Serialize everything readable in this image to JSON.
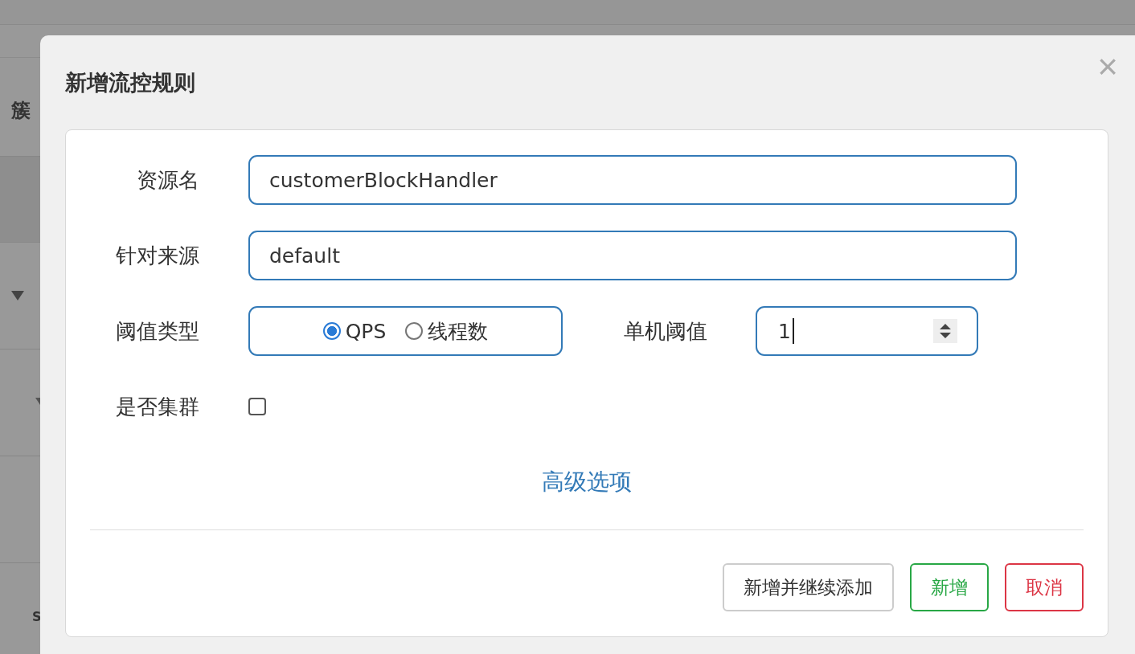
{
  "background": {
    "heading": "簇",
    "footer_text": "S"
  },
  "dialog": {
    "title": "新增流控规则",
    "close": "×",
    "fields": [
      {
        "kind": "text",
        "label": "资源名",
        "value": "customerBlockHandler"
      },
      {
        "kind": "text",
        "label": "针对来源",
        "value": "default"
      },
      {
        "kind": "radio",
        "label": "阈值类型",
        "options": [
          {
            "label": "QPS",
            "selected": true
          },
          {
            "label": "线程数",
            "selected": false
          }
        ],
        "side_label": "单机阈值",
        "side_value": "1"
      },
      {
        "kind": "checkbox",
        "label": "是否集群",
        "checked": false
      }
    ],
    "advanced_link": "高级选项",
    "buttons": [
      {
        "label": "新增并继续添加",
        "kind": "default"
      },
      {
        "label": "新增",
        "kind": "success"
      },
      {
        "label": "取消",
        "kind": "danger"
      }
    ]
  }
}
